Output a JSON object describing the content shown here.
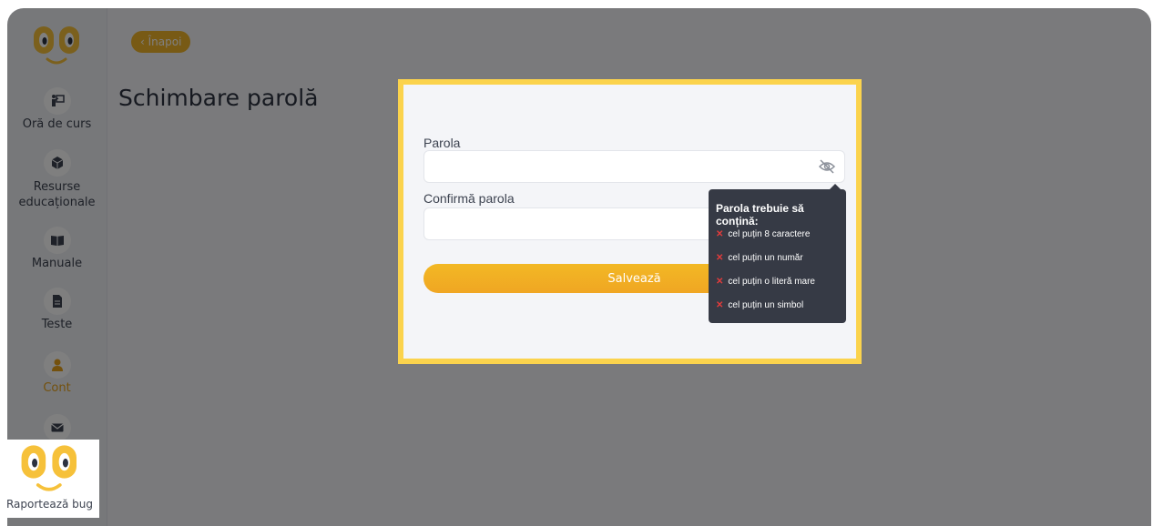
{
  "sidebar": {
    "items": [
      {
        "label": "Oră de curs",
        "icon": "classroom-teacher-icon"
      },
      {
        "label": "Resurse educaționale",
        "icon": "cube-icon"
      },
      {
        "label": "Manuale",
        "icon": "open-book-icon"
      },
      {
        "label": "Teste",
        "icon": "file-icon"
      },
      {
        "label": "Cont",
        "icon": "user-icon",
        "active": true
      },
      {
        "label": "",
        "icon": "envelope-icon"
      }
    ],
    "bug_label": "Raportează bug"
  },
  "header": {
    "back_label": "‹ Înapoi",
    "page_title": "Schimbare parolă"
  },
  "modal": {
    "password_label": "Parola",
    "password_value": "",
    "confirm_label": "Confirmă parola",
    "confirm_value": "",
    "save_label": "Salvează"
  },
  "tooltip": {
    "title": "Parola trebuie să conțină:",
    "rules": [
      "cel puțin 8 caractere",
      "cel puțin un număr",
      "cel puțin o literă mare",
      "cel puțin un simbol"
    ],
    "status_icon": "x-icon"
  },
  "colors": {
    "accent": "#f1b52a",
    "modal_border": "#fbd34d",
    "error": "#e23b3b",
    "tooltip_bg": "#363a45"
  }
}
